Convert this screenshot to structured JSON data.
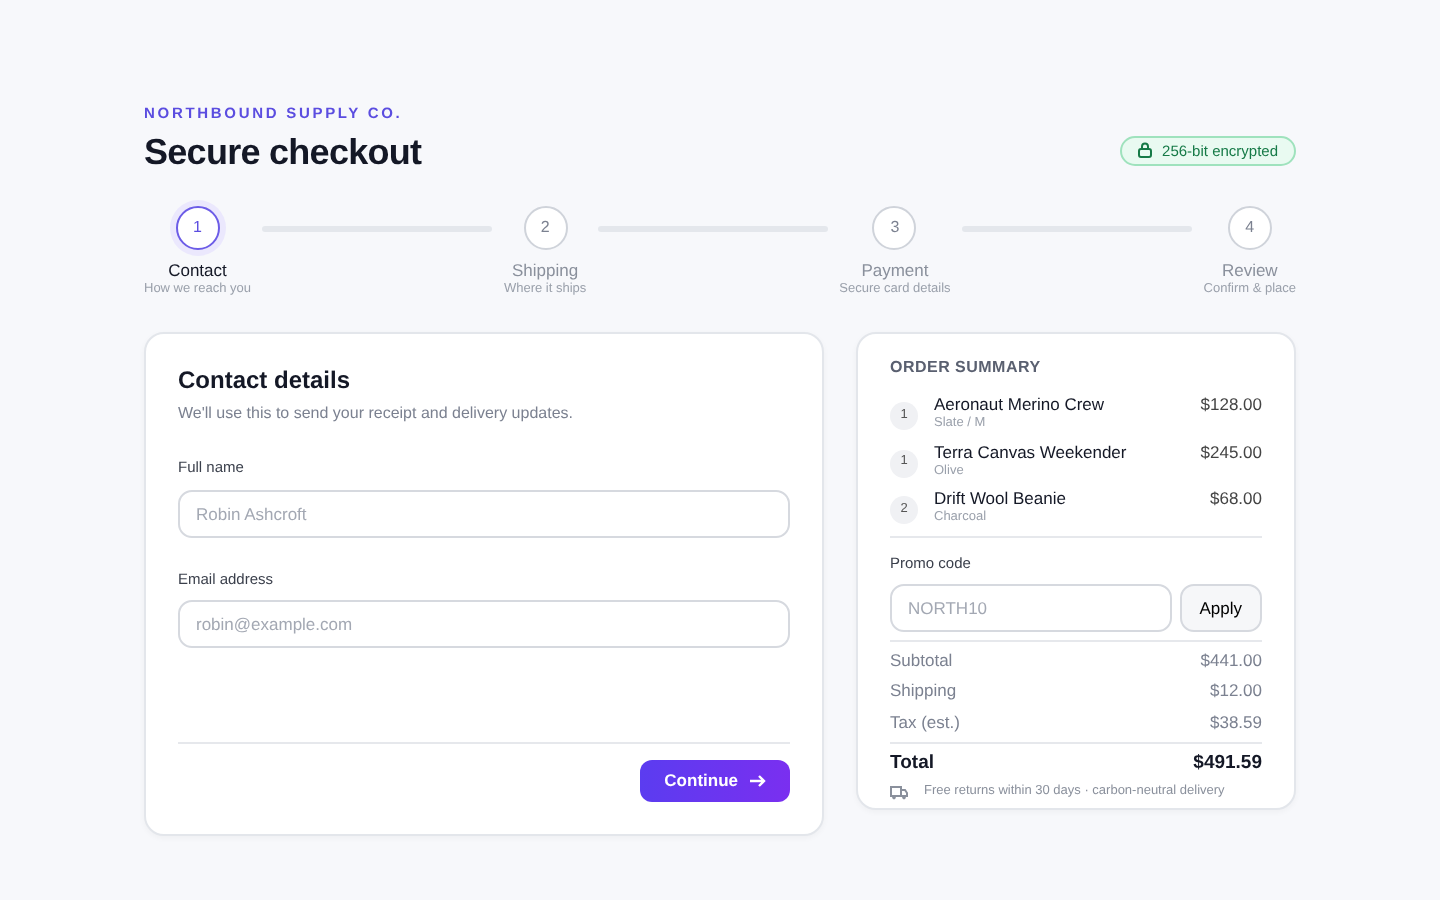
{
  "brand": "NORTHBOUND SUPPLY CO.",
  "title": "Secure checkout",
  "security_badge": "256-bit encrypted",
  "steps": [
    {
      "number": "1",
      "label": "Contact",
      "caption": "How we reach you",
      "selected": true
    },
    {
      "number": "2",
      "label": "Shipping",
      "caption": "Where it ships",
      "selected": false
    },
    {
      "number": "3",
      "label": "Payment",
      "caption": "Secure card details",
      "selected": false
    },
    {
      "number": "4",
      "label": "Review",
      "caption": "Confirm & place",
      "selected": false
    }
  ],
  "contact": {
    "title": "Contact details",
    "subtitle": "We'll use this to send your receipt and delivery updates.",
    "fields": [
      {
        "label": "Full name",
        "placeholder": "Robin Ashcroft"
      },
      {
        "label": "Email address",
        "placeholder": "robin@example.com"
      }
    ],
    "button": "Continue"
  },
  "summary": {
    "title": "ORDER SUMMARY",
    "items": [
      {
        "qty": "1",
        "name": "Aeronaut Merino Crew",
        "variant": "Slate / M",
        "price": "$128.00"
      },
      {
        "qty": "1",
        "name": "Terra Canvas Weekender",
        "variant": "Olive",
        "price": "$245.00"
      },
      {
        "qty": "2",
        "name": "Drift Wool Beanie",
        "variant": "Charcoal",
        "price": "$68.00"
      }
    ],
    "promo": {
      "label": "Promo code",
      "placeholder": "NORTH10",
      "button": "Apply"
    },
    "lines": [
      {
        "label": "Subtotal",
        "value": "$441.00"
      },
      {
        "label": "Shipping",
        "value": "$12.00"
      },
      {
        "label": "Tax (est.)",
        "value": "$38.59"
      }
    ],
    "total": {
      "label": "Total",
      "value": "$491.59"
    },
    "note": "Free returns within 30 days · carbon-neutral delivery"
  }
}
